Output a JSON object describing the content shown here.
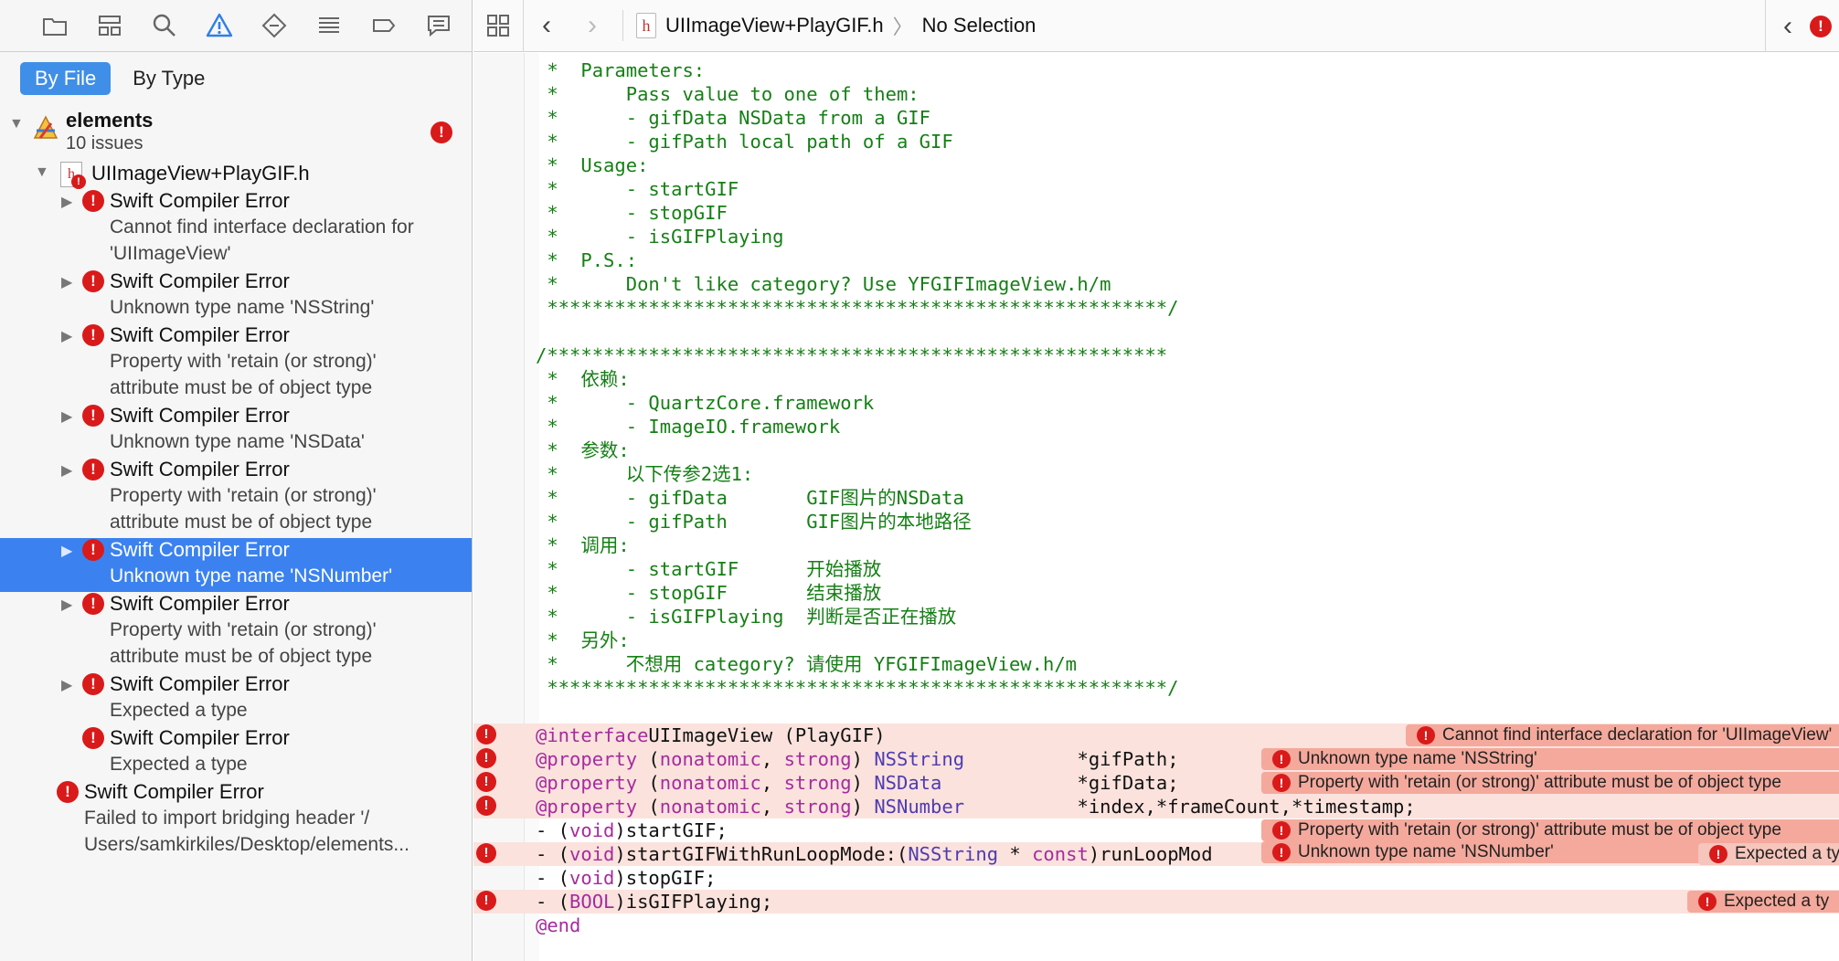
{
  "navigator": {
    "scope_tabs": [
      {
        "label": "By File",
        "active": true
      },
      {
        "label": "By Type",
        "active": false
      }
    ],
    "project": {
      "name": "elements",
      "issue_count": "10 issues"
    },
    "file": {
      "name": "UIImageView+PlayGIF.h"
    },
    "issues": [
      {
        "title": "Swift Compiler Error",
        "lines": [
          "Cannot find interface declaration for",
          "'UIImageView'"
        ]
      },
      {
        "title": "Swift Compiler Error",
        "lines": [
          "Unknown type name 'NSString'"
        ]
      },
      {
        "title": "Swift Compiler Error",
        "lines": [
          "Property with 'retain (or strong)'",
          "attribute must be of object type"
        ]
      },
      {
        "title": "Swift Compiler Error",
        "lines": [
          "Unknown type name 'NSData'"
        ]
      },
      {
        "title": "Swift Compiler Error",
        "lines": [
          "Property with 'retain (or strong)'",
          "attribute must be of object type"
        ]
      },
      {
        "title": "Swift Compiler Error",
        "lines": [
          "Unknown type name 'NSNumber'"
        ],
        "selected": true
      },
      {
        "title": "Swift Compiler Error",
        "lines": [
          "Property with 'retain (or strong)'",
          "attribute must be of object type"
        ]
      },
      {
        "title": "Swift Compiler Error",
        "lines": [
          "Expected a type"
        ]
      },
      {
        "title": "Swift Compiler Error",
        "lines": [
          "Expected a type"
        ]
      }
    ],
    "bridging_error": {
      "title": "Swift Compiler Error",
      "lines": [
        "Failed to import bridging header '/",
        "Users/samkirkiles/Desktop/elements..."
      ]
    }
  },
  "jump_bar": {
    "file": "UIImageView+PlayGIF.h",
    "selection": "No Selection",
    "file_icon_letter": "h"
  },
  "code": {
    "comment_lines": [
      " *  Parameters:",
      " *      Pass value to one of them:",
      " *      - gifData NSData from a GIF",
      " *      - gifPath local path of a GIF",
      " *  Usage:",
      " *      - startGIF",
      " *      - stopGIF",
      " *      - isGIFPlaying",
      " *  P.S.:",
      " *      Don't like category? Use YFGIFImageView.h/m",
      " *******************************************************/",
      "",
      "/*******************************************************",
      " *  依赖:",
      " *      - QuartzCore.framework",
      " *      - ImageIO.framework",
      " *  参数:",
      " *      以下传参2选1:",
      " *      - gifData       GIF图片的NSData",
      " *      - gifPath       GIF图片的本地路径",
      " *  调用:",
      " *      - startGIF      开始播放",
      " *      - stopGIF       结束播放",
      " *      - isGIFPlaying  判断是否正在播放",
      " *  另外:",
      " *      不想用 category? 请使用 YFGIFImageView.h/m",
      " *******************************************************/",
      ""
    ],
    "decl_lines": [
      {
        "parts": [
          [
            "kw",
            "@interface"
          ],
          [
            "",
            "UIImageView (PlayGIF)"
          ]
        ],
        "error": true,
        "msg": "Cannot find interface declaration for 'UIImageView'"
      },
      {
        "parts": [
          [
            "kw",
            "@property"
          ],
          [
            "",
            " ("
          ],
          [
            "kw",
            "nonatomic"
          ],
          [
            "",
            ", "
          ],
          [
            "kw",
            "strong"
          ],
          [
            "",
            ") "
          ],
          [
            "typ",
            "NSString"
          ],
          [
            "",
            "          *gifPath;"
          ]
        ],
        "error": true,
        "msg": "Unknown type name 'NSString'"
      },
      {
        "parts": [
          [
            "kw",
            "@property"
          ],
          [
            "",
            " ("
          ],
          [
            "kw",
            "nonatomic"
          ],
          [
            "",
            ", "
          ],
          [
            "kw",
            "strong"
          ],
          [
            "",
            ") "
          ],
          [
            "typ",
            "NSData"
          ],
          [
            "",
            "            *gifData;"
          ]
        ],
        "error": true,
        "msg": "Property with 'retain (or strong)' attribute must be of object type"
      },
      {
        "parts": [
          [
            "kw",
            "@property"
          ],
          [
            "",
            " ("
          ],
          [
            "kw",
            "nonatomic"
          ],
          [
            "",
            ", "
          ],
          [
            "kw",
            "strong"
          ],
          [
            "",
            ") "
          ],
          [
            "typ",
            "NSNumber"
          ],
          [
            "",
            "          *index,*frameCount,*timestamp;"
          ]
        ],
        "error": true,
        "msg": ""
      },
      {
        "parts": [
          [
            "",
            "- ("
          ],
          [
            "kw",
            "void"
          ],
          [
            "",
            ")startGIF;"
          ]
        ],
        "error": false,
        "msg": "Property with 'retain (or strong)' attribute must be of object type"
      },
      {
        "parts": [
          [
            "",
            "- ("
          ],
          [
            "kw",
            "void"
          ],
          [
            "",
            ")startGIFWithRunLoopMode:("
          ],
          [
            "typ",
            "NSString"
          ],
          [
            "",
            " * "
          ],
          [
            "kw",
            "const"
          ],
          [
            "",
            ")runLoopMod"
          ]
        ],
        "error": true,
        "msg": "Unknown type name 'NSNumber'",
        "msg2": "Expected a ty"
      },
      {
        "parts": [
          [
            "",
            "- ("
          ],
          [
            "kw",
            "void"
          ],
          [
            "",
            ")stopGIF;"
          ]
        ],
        "error": false,
        "msg": ""
      },
      {
        "parts": [
          [
            "",
            "- ("
          ],
          [
            "kw",
            "BOOL"
          ],
          [
            "",
            ")isGIFPlaying;"
          ]
        ],
        "error": true,
        "msg": "Expected a ty"
      },
      {
        "parts": [
          [
            "kw",
            "@end"
          ]
        ],
        "error": false,
        "msg": ""
      }
    ]
  },
  "colors": {
    "accent": "#3b82f0",
    "error": "#d91a1a",
    "comment": "#157f15",
    "keyword": "#a52b9e",
    "type": "#4d3cb0"
  }
}
